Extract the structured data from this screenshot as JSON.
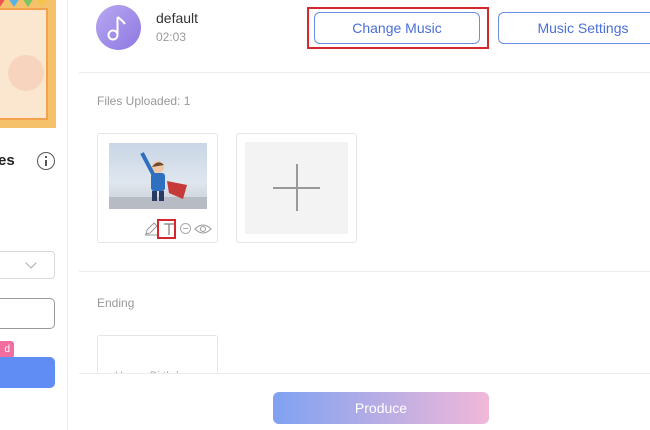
{
  "sidebar": {
    "title_fragment": "es",
    "badge_fragment": "d"
  },
  "music": {
    "name": "default",
    "duration": "02:03",
    "change_label": "Change Music",
    "settings_label": "Music Settings"
  },
  "files": {
    "uploaded_label": "Files Uploaded: 1",
    "photo_tools": [
      "pencil-icon",
      "text-icon",
      "remove-icon",
      "eye-icon"
    ]
  },
  "ending": {
    "label": "Ending",
    "card_text": "Happy Birthday"
  },
  "footer": {
    "produce_label": "Produce"
  },
  "colors": {
    "accent": "#4a6fd8",
    "highlight": "#d4272e",
    "badge": "#f36ea0",
    "primary_button": "#5f8df3"
  }
}
